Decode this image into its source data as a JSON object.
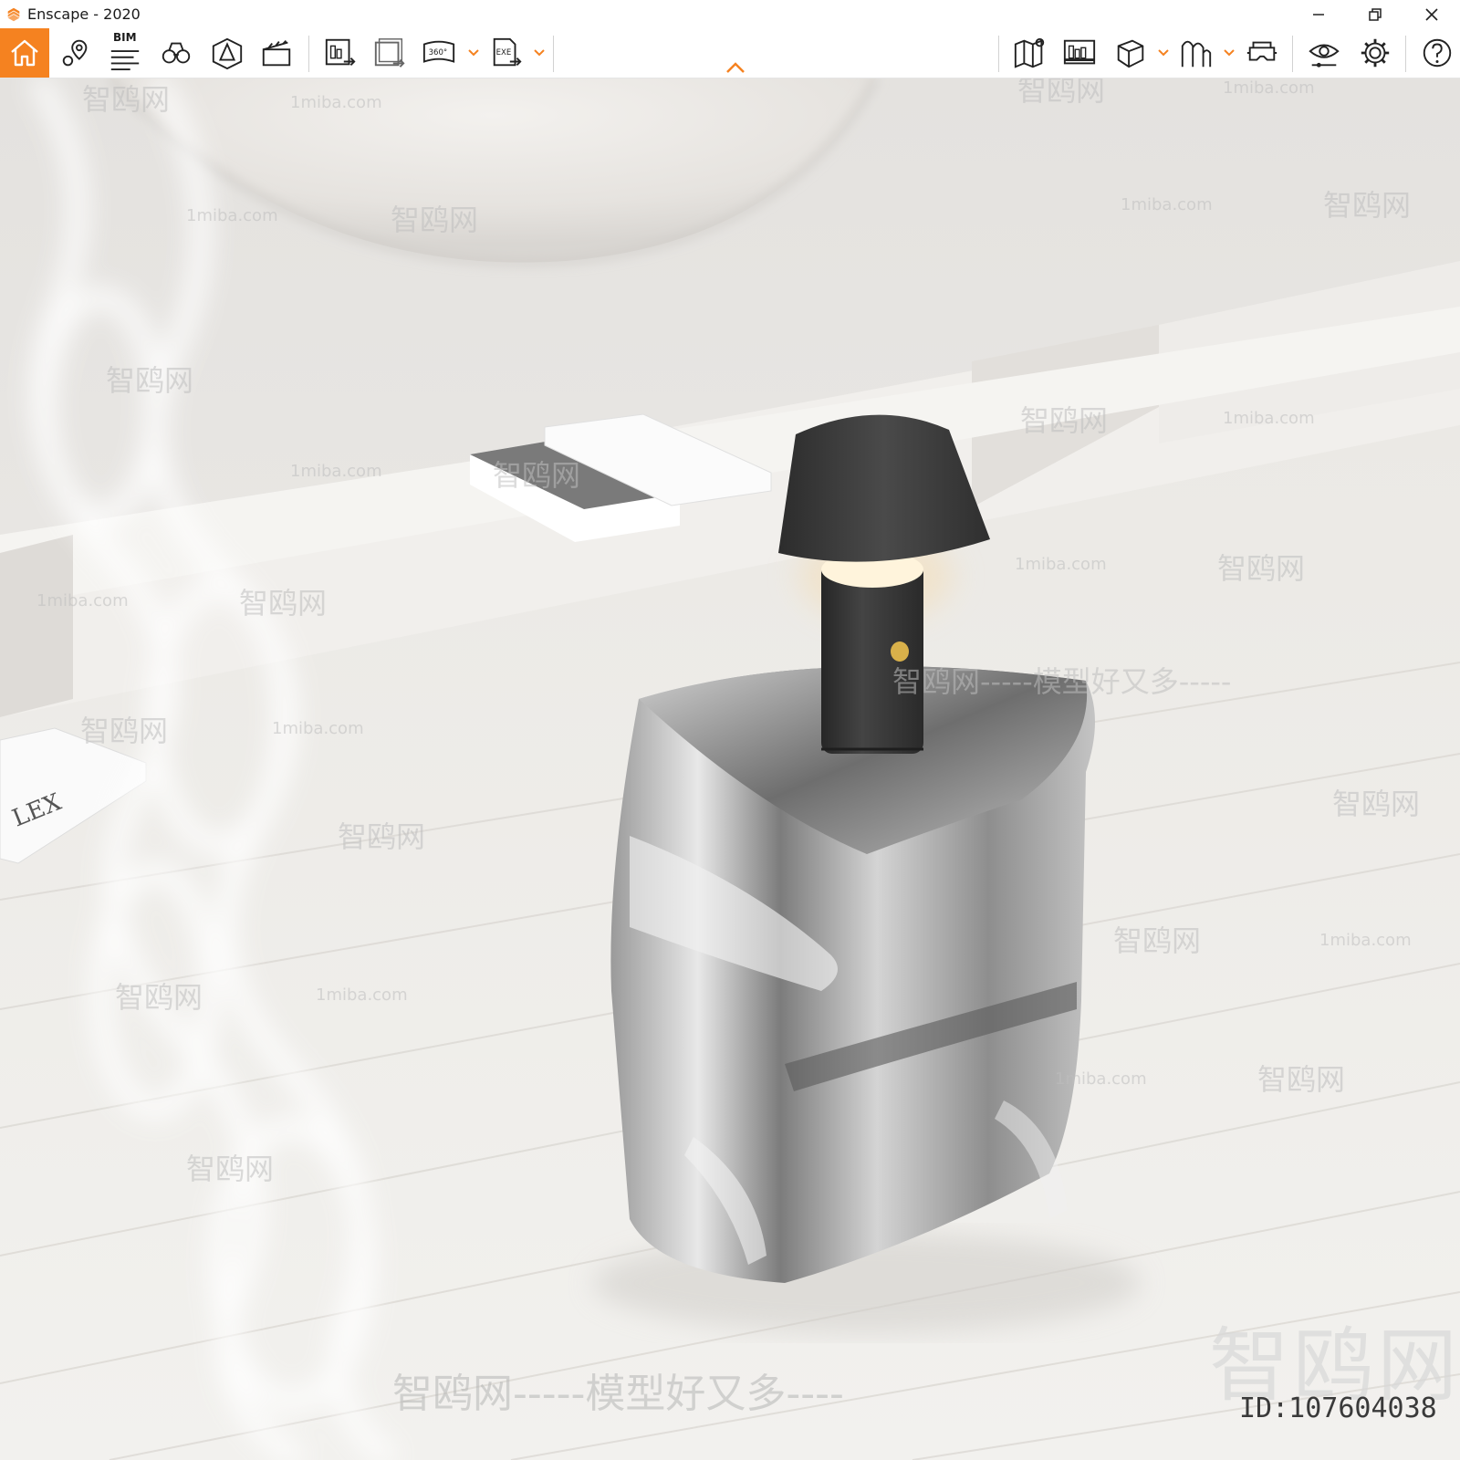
{
  "window": {
    "title": "Enscape - 2020",
    "accent_color": "#f58220",
    "controls": [
      "minimize-icon",
      "restore-icon",
      "close-icon"
    ]
  },
  "toolbar": {
    "bim_label": "BIM",
    "buttons": [
      {
        "name": "home",
        "icon": "home-icon",
        "active": true
      },
      {
        "name": "views",
        "icon": "location-pin-icon"
      },
      {
        "name": "bim-info",
        "icon": "bim-list-icon"
      },
      {
        "name": "binoculars",
        "icon": "binoculars-icon"
      },
      {
        "name": "sun-settings",
        "icon": "sun-triangle-icon"
      },
      {
        "name": "video-editor",
        "icon": "clapperboard-icon"
      },
      {
        "name": "export-image",
        "icon": "image-export-icon"
      },
      {
        "name": "batch-render",
        "icon": "batch-export-icon"
      },
      {
        "name": "export-360",
        "icon": "panorama-360-icon",
        "label": "360°"
      },
      {
        "name": "export-exe",
        "icon": "exe-export-icon",
        "label": "EXE"
      },
      {
        "name": "map",
        "icon": "map-icon"
      },
      {
        "name": "capture-images",
        "icon": "capture-icon"
      },
      {
        "name": "section-box",
        "icon": "cube-icon"
      },
      {
        "name": "asset-library",
        "icon": "asset-library-icon"
      },
      {
        "name": "vr-headset",
        "icon": "vr-headset-icon"
      },
      {
        "name": "visual-settings",
        "icon": "eye-settings-icon"
      },
      {
        "name": "settings",
        "icon": "gear-icon"
      },
      {
        "name": "help",
        "icon": "help-icon"
      }
    ]
  },
  "watermarks": {
    "site": "1miba.com",
    "site_cn": "智鸥网",
    "slogan": "智鸥网-----模型好又多----",
    "slogan_mid": "智鸥网-----模型好又多-----",
    "logo_text": "智鸥网",
    "id_text": "ID:107604038"
  },
  "scene": {
    "book_cover_text": "LEX",
    "colors": {
      "wall": "#ebe9e6",
      "floor": "#e9e7e3",
      "chrome": "#b8b8b8",
      "lamp": "#3a3a3a",
      "glow": "#f4dcb2"
    }
  }
}
